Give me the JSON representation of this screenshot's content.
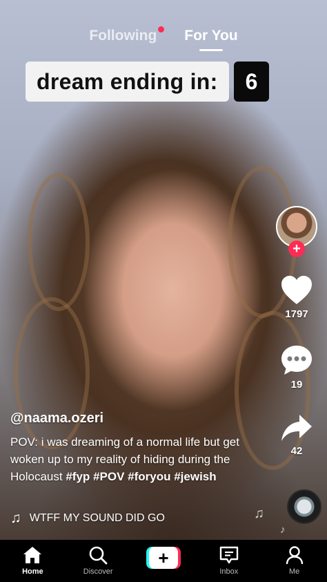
{
  "top_nav": {
    "following": "Following",
    "for_you": "For You"
  },
  "banner": {
    "text": "dream ending in:",
    "count": "6"
  },
  "rail": {
    "likes": "1797",
    "comments": "19",
    "shares": "42",
    "follow_symbol": "+"
  },
  "caption": {
    "username": "@naama.ozeri",
    "text": "POV: i was dreaming of a normal life but get woken up to my reality of hiding during the Holocaust",
    "tags": [
      "#fyp",
      "#POV",
      "#foryou",
      "#jewish"
    ]
  },
  "sound": {
    "title": "WTFF MY SOUND DID GO",
    "icon": "music-note-icon"
  },
  "bottom_nav": {
    "home": "Home",
    "discover": "Discover",
    "create": "+",
    "inbox": "Inbox",
    "me": "Me"
  },
  "colors": {
    "accent": "#fe2c55",
    "cyan": "#25f4ee"
  }
}
